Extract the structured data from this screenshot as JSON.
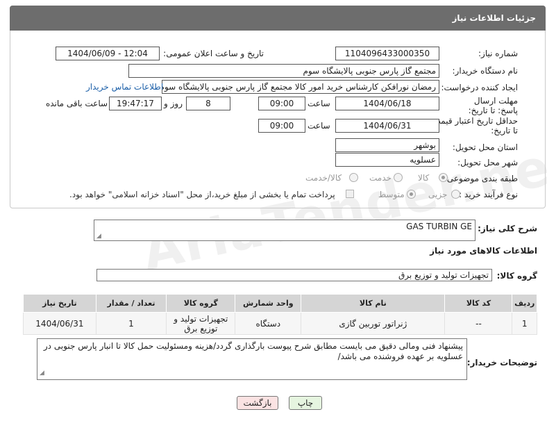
{
  "header": {
    "title": "جزئیات اطلاعات نیاز"
  },
  "fields": {
    "need_number_label": "شماره نیاز:",
    "need_number": "1104096433000350",
    "announce_label": "تاریخ و ساعت اعلان عمومی:",
    "announce_value": "1404/06/09 - 12:04",
    "buyer_label": "نام دستگاه خریدار:",
    "buyer_value": "مجتمع گاز پارس جنوبی  پالایشگاه سوم",
    "creator_label": "ایجاد کننده درخواست:",
    "creator_value": "رمضان نورافکن کارشناس خرید امور کالا مجتمع گاز پارس جنوبی  پالایشگاه سوم",
    "contact_link": "اطلاعات تماس خریدار",
    "deadline_label": "مهلت ارسال پاسخ: تا تاریخ:",
    "deadline_date": "1404/06/18",
    "time_word": "ساعت",
    "deadline_time": "09:00",
    "days_value": "8",
    "days_word": "روز و",
    "remaining_time": "19:47:17",
    "remaining_word": "ساعت باقی مانده",
    "validity_label": "حداقل تاریخ اعتبار قیمت: تا تاریخ:",
    "validity_date": "1404/06/31",
    "validity_time": "09:00",
    "province_label": "استان محل تحویل:",
    "province_value": "بوشهر",
    "city_label": "شهر محل تحویل:",
    "city_value": "عسلویه",
    "category_label": "طبقه بندی موضوعی:",
    "category_options": [
      "کالا",
      "خدمت",
      "کالا/خدمت"
    ],
    "process_label": "نوع فرآیند خرید :",
    "process_options": [
      "جزیی",
      "متوسط"
    ],
    "payment_note": "پرداخت تمام یا بخشی از مبلغ خرید،از محل \"اسناد خزانه اسلامی\" خواهد بود."
  },
  "description": {
    "label": "شرح کلی نیاز:",
    "value": "GAS TURBIN GE"
  },
  "goods": {
    "section_title": "اطلاعات کالاهای مورد نیاز",
    "group_label": "گروه کالا:",
    "group_value": "تجهیزات تولید و توزیع برق",
    "columns": [
      "ردیف",
      "کد کالا",
      "نام کالا",
      "واحد شمارش",
      "گروه کالا",
      "تعداد / مقدار",
      "تاریخ نیاز"
    ],
    "rows": [
      [
        "1",
        "--",
        "ژنراتور توربین گازی",
        "دستگاه",
        "تجهیزات تولید و توزیع برق",
        "1",
        "1404/06/31"
      ]
    ]
  },
  "buyer_notes": {
    "label": "توضیحات خریدار:",
    "value": "پیشنهاد فنی ومالی دقیق می بایست مطابق شرح پیوست بارگذاری گردد/هزینه ومسئولیت حمل کالا تا انبار پارس جنوبی در عسلویه بر عهده فروشنده می باشد/"
  },
  "buttons": {
    "print": "چاپ",
    "back": "بازگشت"
  },
  "watermark": "AriaTender.net",
  "colors": {
    "header_bg": "#6d6d6d",
    "print_btn": "#e6f5e0",
    "back_btn": "#fbe3e3",
    "link": "#1b5fa8"
  }
}
